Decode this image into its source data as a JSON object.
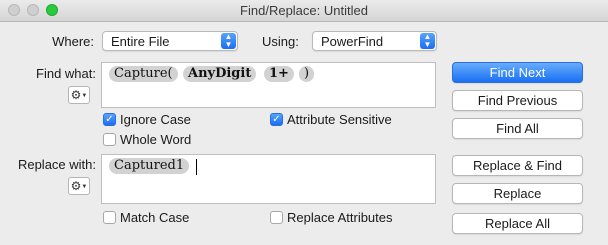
{
  "window": {
    "title": "Find/Replace: Untitled"
  },
  "where": {
    "label": "Where:",
    "value": "Entire File"
  },
  "using": {
    "label": "Using:",
    "value": "PowerFind"
  },
  "find": {
    "label": "Find what:",
    "tokens": [
      "Capture(",
      "AnyDigit",
      "1+",
      ")"
    ]
  },
  "replace": {
    "label": "Replace with:",
    "tokens": [
      "Captured1"
    ]
  },
  "options": {
    "ignore_case": {
      "label": "Ignore Case",
      "checked": true
    },
    "attribute_sensitive": {
      "label": "Attribute Sensitive",
      "checked": true
    },
    "whole_word": {
      "label": "Whole Word",
      "checked": false
    },
    "match_case": {
      "label": "Match Case",
      "checked": false
    },
    "replace_attributes": {
      "label": "Replace Attributes",
      "checked": false
    }
  },
  "buttons": {
    "find_next": "Find Next",
    "find_previous": "Find Previous",
    "find_all": "Find All",
    "replace_find": "Replace & Find",
    "replace": "Replace",
    "replace_all": "Replace All"
  },
  "icons": {
    "gear": "gear-icon",
    "check": "checkmark-icon",
    "popup_arrows": "popup-arrows-icon"
  },
  "colors": {
    "accent": "#1a6ff4",
    "token_bg": "#d2d2d2"
  }
}
